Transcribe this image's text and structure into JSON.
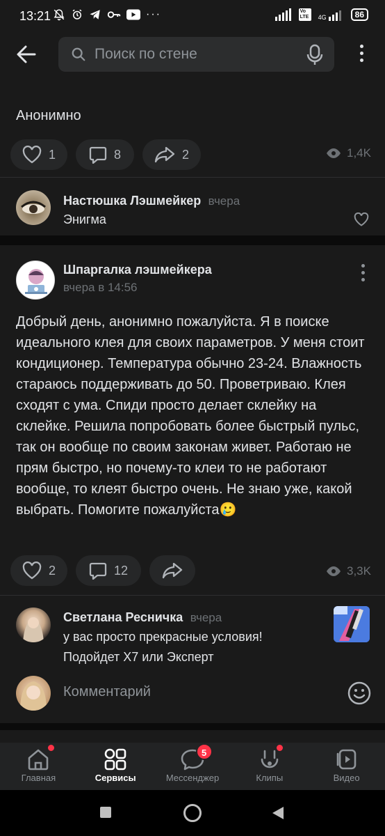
{
  "status": {
    "time": "13:21",
    "signal": "Vo LTE",
    "net": "4G",
    "battery": "86"
  },
  "search": {
    "placeholder": "Поиск по стене"
  },
  "post1": {
    "text": "Анонимно",
    "likes": "1",
    "comments": "8",
    "shares": "2",
    "views": "1,4K",
    "comment": {
      "author": "Настюшка Лэшмейкер",
      "time": "вчера",
      "text": "Энигма"
    }
  },
  "post2": {
    "author": "Шпаргалка лэшмейкера",
    "time": "вчера в 14:56",
    "text": "Добрый день, анонимно пожалуйста. Я в поиске идеального клея для своих параметров. У меня стоит кондиционер. Температура обычно 23-24. Влажность стараюсь поддерживать до 50. Проветриваю. Клея сходят с ума. Спиди просто делает склейку на склейке. Решила попробовать более быстрый пульс, так он вообще по своим законам живет. Работаю не прям быстро, но почему-то клеи то не работают вообще, то клеят быстро очень. Не знаю уже, какой выбрать. Помогите пожалуйста🥲",
    "likes": "2",
    "comments": "12",
    "views": "3,3K",
    "comment": {
      "author": "Светлана Ресничка",
      "time": "вчера",
      "line1": "у вас просто прекрасные условия!",
      "line2": "Подойдет Х7 или Эксперт"
    },
    "comment_placeholder": "Комментарий"
  },
  "nav": [
    {
      "label": "Главная",
      "icon": "home-icon",
      "dot": true
    },
    {
      "label": "Сервисы",
      "icon": "services-icon",
      "active": true
    },
    {
      "label": "Мессенджер",
      "icon": "messenger-icon",
      "badge": "5"
    },
    {
      "label": "Клипы",
      "icon": "clips-icon",
      "dot": true
    },
    {
      "label": "Видео",
      "icon": "video-icon"
    }
  ]
}
